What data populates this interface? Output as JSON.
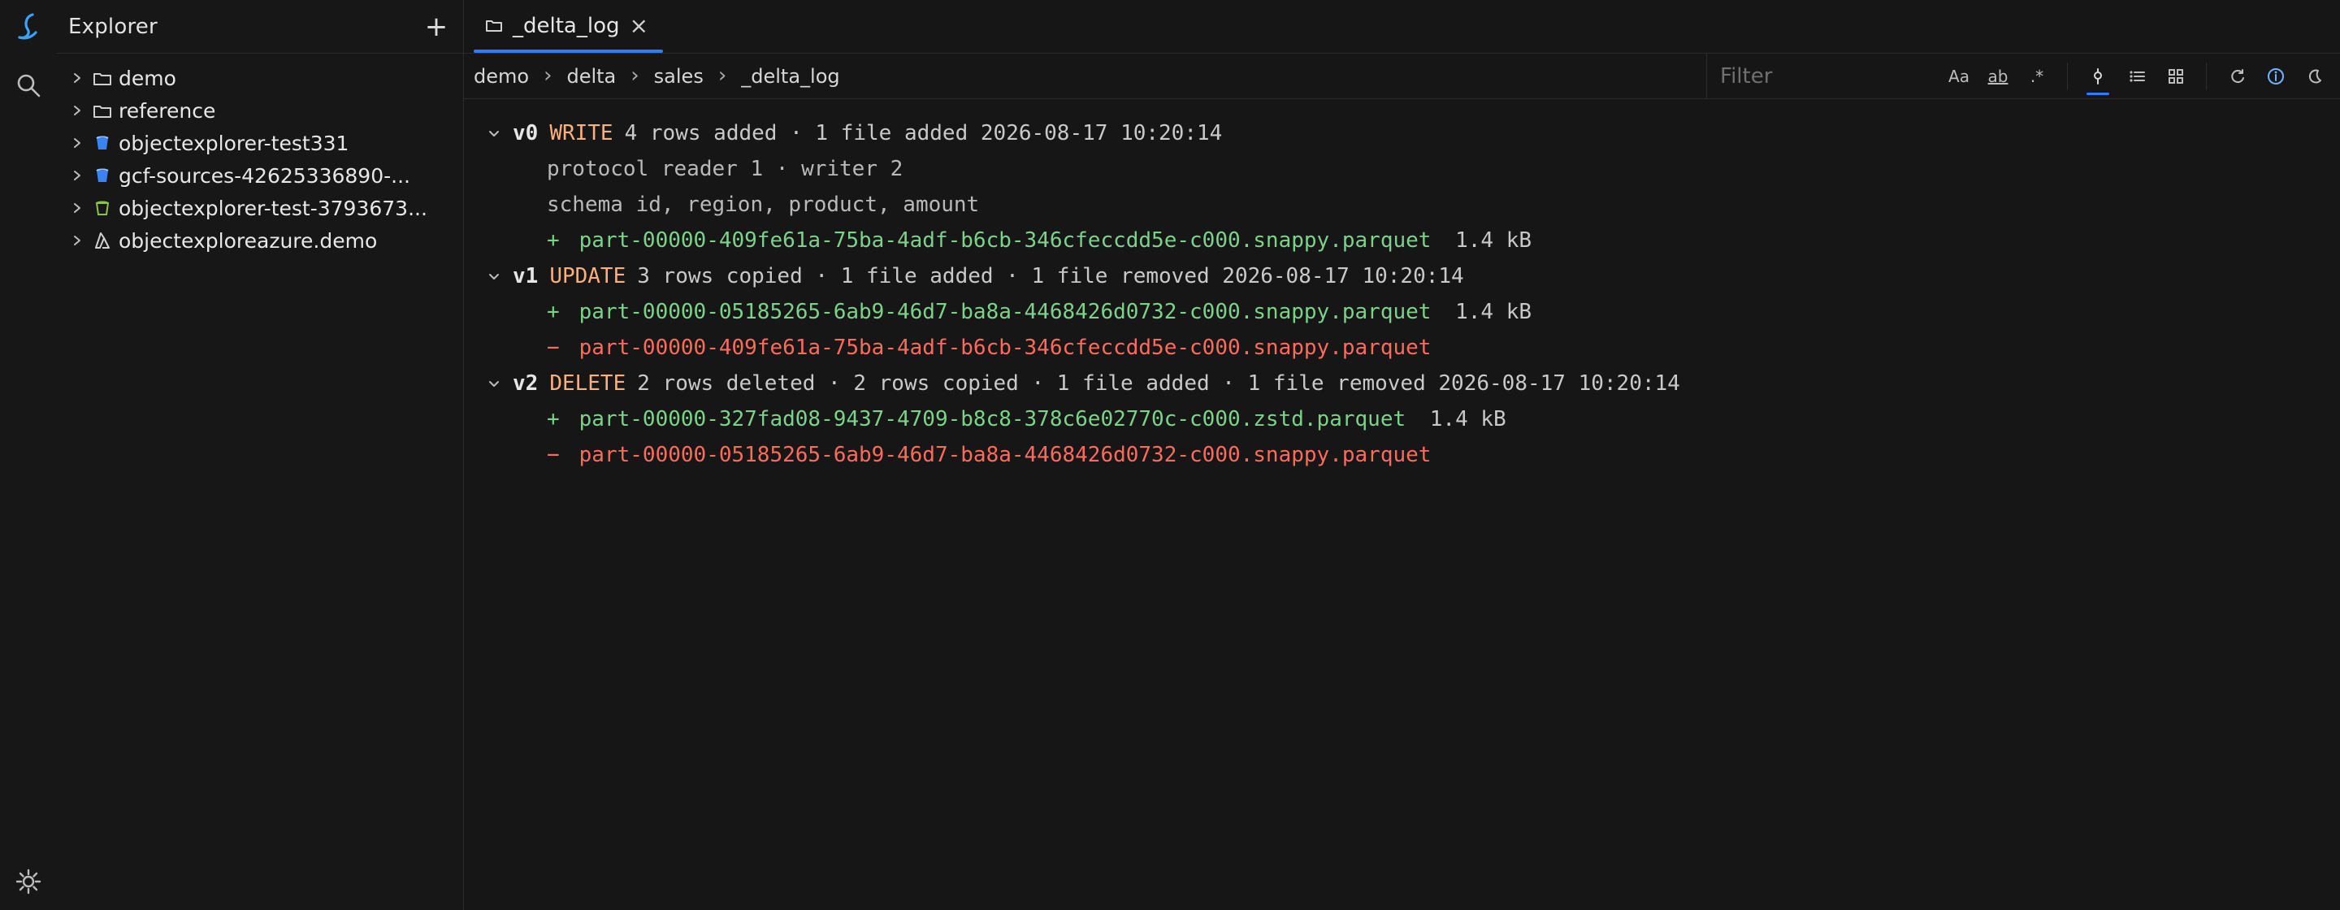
{
  "activity": {
    "icons": [
      "logo-icon",
      "search-icon",
      "settings-icon"
    ]
  },
  "sidebar": {
    "title": "Explorer",
    "add": "+",
    "items": [
      {
        "label": "demo",
        "icon": "folder-icon"
      },
      {
        "label": "reference",
        "icon": "folder-icon"
      },
      {
        "label": "objectexplorer-test331",
        "icon": "bucket-icon"
      },
      {
        "label": "gcf-sources-42625336890-...",
        "icon": "bucket-icon"
      },
      {
        "label": "objectexplorer-test-3793673...",
        "icon": "bucket-outline-icon"
      },
      {
        "label": "objectexploreazure.demo",
        "icon": "azure-icon"
      }
    ]
  },
  "tabs": [
    {
      "label": "_delta_log",
      "icon": "folder-icon"
    }
  ],
  "breadcrumbs": [
    "demo",
    "delta",
    "sales",
    "_delta_log"
  ],
  "filter": {
    "placeholder": "Filter"
  },
  "tools": {
    "case": "Aa",
    "word": "ab",
    "regex": ".*"
  },
  "log": {
    "v0": {
      "version": "v0",
      "op": "WRITE",
      "meta": "4 rows added · 1 file added 2026-08-17 10:20:14",
      "lines": [
        "protocol reader 1 · writer 2",
        "schema id, region, product, amount"
      ],
      "files": [
        {
          "sign": "+",
          "name": "part-00000-409fe61a-75ba-4adf-b6cb-346cfeccdd5e-c000.snappy.parquet",
          "size": "1.4 kB",
          "type": "add"
        }
      ]
    },
    "v1": {
      "version": "v1",
      "op": "UPDATE",
      "meta": "3 rows copied · 1 file added · 1 file removed 2026-08-17 10:20:14",
      "files": [
        {
          "sign": "+",
          "name": "part-00000-05185265-6ab9-46d7-ba8a-4468426d0732-c000.snappy.parquet",
          "size": "1.4 kB",
          "type": "add"
        },
        {
          "sign": "−",
          "name": "part-00000-409fe61a-75ba-4adf-b6cb-346cfeccdd5e-c000.snappy.parquet",
          "size": "",
          "type": "remove"
        }
      ]
    },
    "v2": {
      "version": "v2",
      "op": "DELETE",
      "meta": "2 rows deleted · 2 rows copied · 1 file added · 1 file removed 2026-08-17 10:20:14",
      "files": [
        {
          "sign": "+",
          "name": "part-00000-327fad08-9437-4709-b8c8-378c6e02770c-c000.zstd.parquet",
          "size": "1.4 kB",
          "type": "add"
        },
        {
          "sign": "−",
          "name": "part-00000-05185265-6ab9-46d7-ba8a-4468426d0732-c000.snappy.parquet",
          "size": "",
          "type": "remove"
        }
      ]
    }
  }
}
